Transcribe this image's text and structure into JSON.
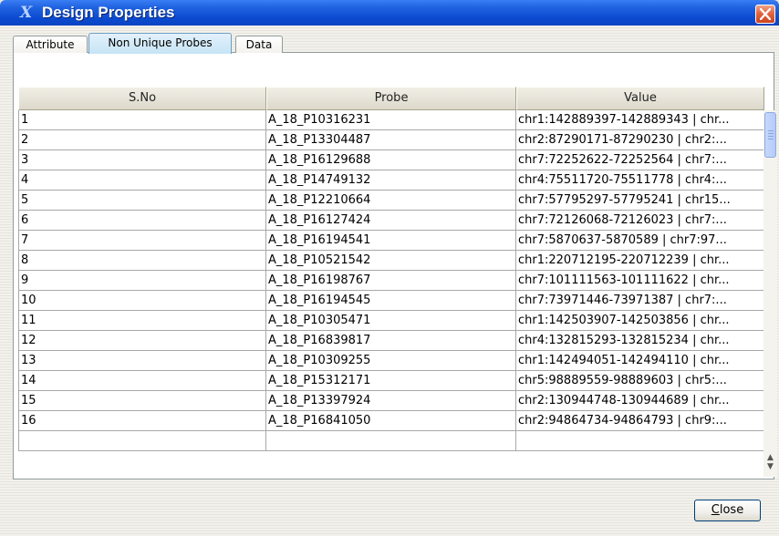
{
  "window": {
    "title": "Design Properties",
    "app_icon": "app-logo-icon",
    "close_icon": "close-icon"
  },
  "tabs": [
    {
      "label": "Attribute",
      "active": false
    },
    {
      "label": "Non Unique Probes",
      "active": true
    },
    {
      "label": "Data",
      "active": false
    }
  ],
  "table": {
    "columns": [
      "S.No",
      "Probe",
      "Value"
    ],
    "rows": [
      [
        "1",
        "A_18_P10316231",
        "chr1:142889397-142889343 | chr..."
      ],
      [
        "2",
        "A_18_P13304487",
        "chr2:87290171-87290230 | chr2:..."
      ],
      [
        "3",
        "A_18_P16129688",
        "chr7:72252622-72252564 | chr7:..."
      ],
      [
        "4",
        "A_18_P14749132",
        "chr4:75511720-75511778 | chr4:..."
      ],
      [
        "5",
        "A_18_P12210664",
        "chr7:57795297-57795241 | chr15..."
      ],
      [
        "6",
        "A_18_P16127424",
        "chr7:72126068-72126023 | chr7:..."
      ],
      [
        "7",
        "A_18_P16194541",
        "chr7:5870637-5870589 | chr7:97..."
      ],
      [
        "8",
        "A_18_P10521542",
        "chr1:220712195-220712239 | chr..."
      ],
      [
        "9",
        "A_18_P16198767",
        "chr7:101111563-101111622 | chr..."
      ],
      [
        "10",
        "A_18_P16194545",
        "chr7:73971446-73971387 | chr7:..."
      ],
      [
        "11",
        "A_18_P10305471",
        "chr1:142503907-142503856 | chr..."
      ],
      [
        "12",
        "A_18_P16839817",
        "chr4:132815293-132815234 | chr..."
      ],
      [
        "13",
        "A_18_P10309255",
        "chr1:142494051-142494110 | chr..."
      ],
      [
        "14",
        "A_18_P15312171",
        "chr5:98889559-98889603 | chr5:..."
      ],
      [
        "15",
        "A_18_P13397924",
        "chr2:130944748-130944689 | chr..."
      ],
      [
        "16",
        "A_18_P16841050",
        "chr2:94864734-94864793 | chr9:..."
      ]
    ]
  },
  "footer": {
    "close_label": "Close",
    "close_mnemonic": "C",
    "close_rest": "lose"
  }
}
